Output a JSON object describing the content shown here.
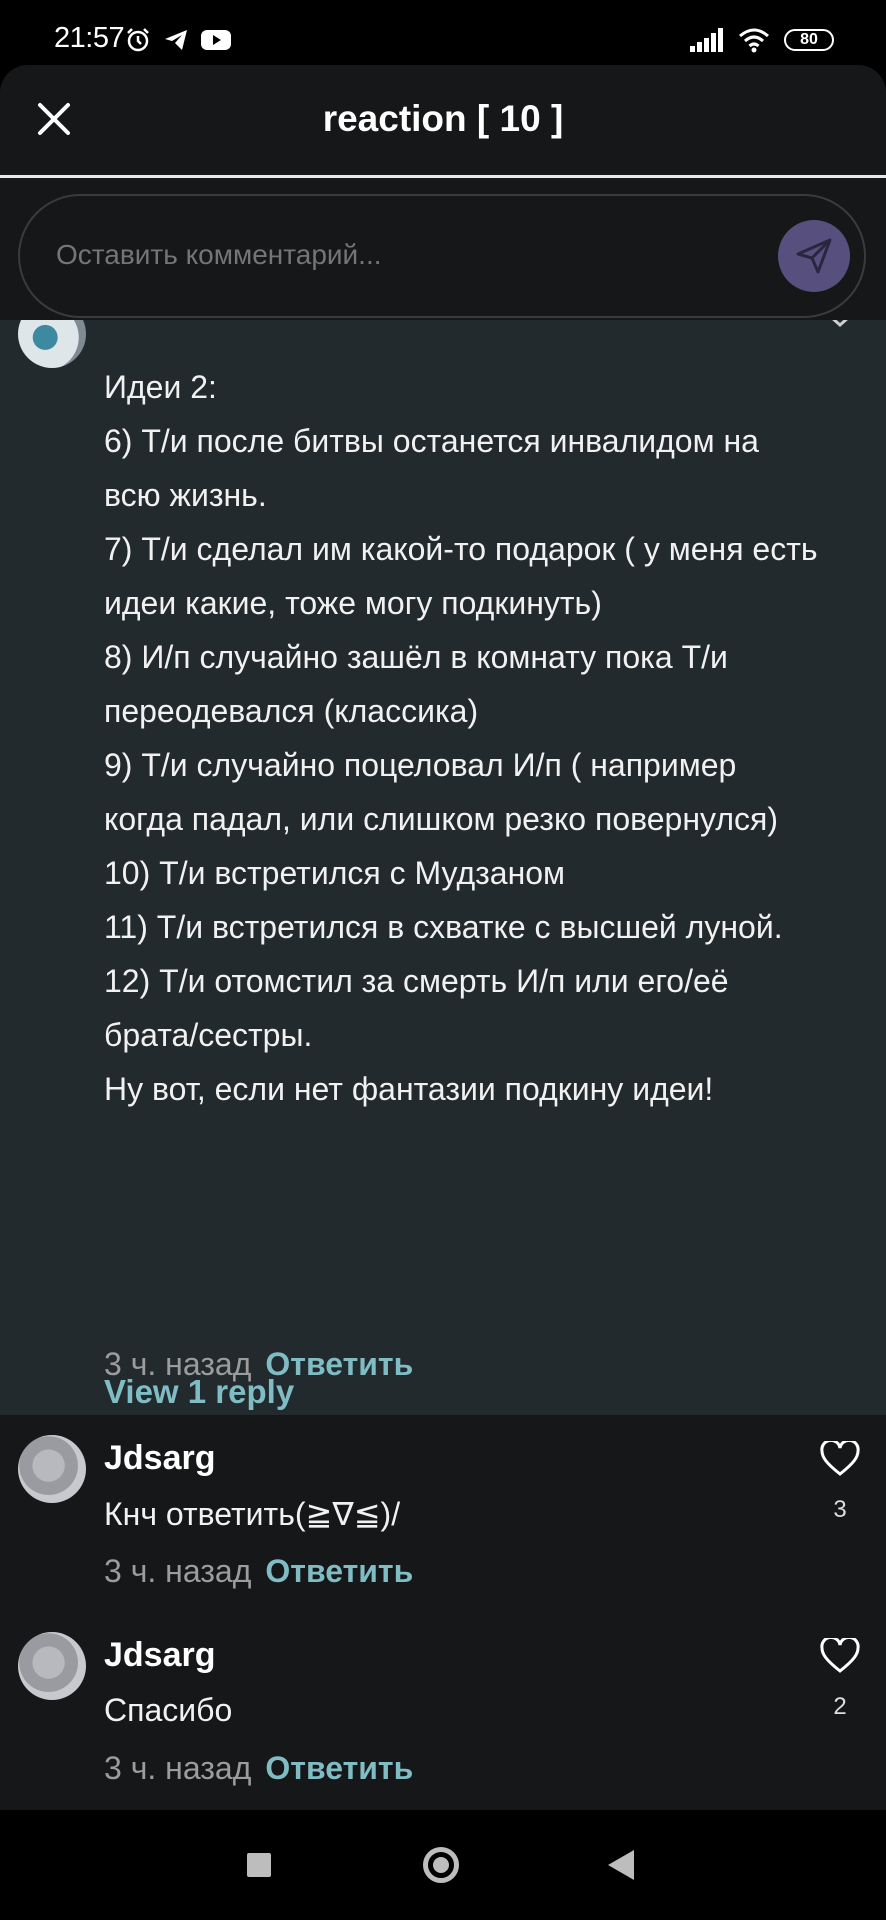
{
  "status_bar": {
    "time": "21:57",
    "battery": "80",
    "icons": [
      "alarm-icon",
      "telegram-icon",
      "youtube-icon",
      "signal-icon",
      "wifi-icon",
      "battery-icon"
    ]
  },
  "header": {
    "title": "reaction [ 10 ]"
  },
  "composer": {
    "placeholder": "Оставить комментарий..."
  },
  "highlight_comment": {
    "body": "Идеи 2:\n6) Т/и после битвы останется инвалидом на всю жизнь.\n7) Т/и сделал им какой-то подарок ( у меня есть идеи какие, тоже могу подкинуть)\n8) И/п случайно зашёл в комнату пока Т/и переодевался (классика)\n9) Т/и случайно поцеловал И/п ( например когда падал, или слишком резко повернулся)\n10) Т/и встретился с Мудзаном\n11) Т/и встретился в схватке с высшей луной.\n12) Т/и отомстил за смерть И/п или его/её брата/сестры.\nНу вот, если нет фантазии подкину идеи!",
    "time": "3 ч. назад",
    "reply_label": "Ответить"
  },
  "view_replies": "View 1 reply",
  "replies": [
    {
      "user": "Jdsarg",
      "text": "Кнч ответить(≧∇≦)/",
      "time": "3 ч. назад",
      "reply_label": "Ответить",
      "likes": "3"
    },
    {
      "user": "Jdsarg",
      "text": "Спасибо",
      "time": "3 ч. назад",
      "reply_label": "Ответить",
      "likes": "2"
    }
  ],
  "colors": {
    "accent": "#7fbcc4",
    "send_button": "#57507e",
    "highlight_bg": "#222a2d",
    "sheet_bg": "#161718"
  }
}
